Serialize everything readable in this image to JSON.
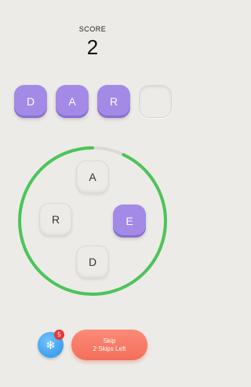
{
  "score": {
    "label": "SCORE",
    "value": "2"
  },
  "answer_slots": [
    "D",
    "A",
    "R",
    ""
  ],
  "letter_tiles": {
    "top": "A",
    "left": "R",
    "right": "E",
    "bottom": "D"
  },
  "timer": {
    "progress": 0.93,
    "color": "#4cc45a",
    "track_color": "#dcdad6"
  },
  "powerups": {
    "freeze_count": "5",
    "freeze_icon": "snowflake-icon"
  },
  "skip_button": {
    "line1": "Skip",
    "line2": "2 Skips Left"
  },
  "colors": {
    "tile_active": "#a38ae6",
    "skip": "#f46f5a",
    "freeze": "#2d8fe3",
    "badge": "#e53935"
  }
}
